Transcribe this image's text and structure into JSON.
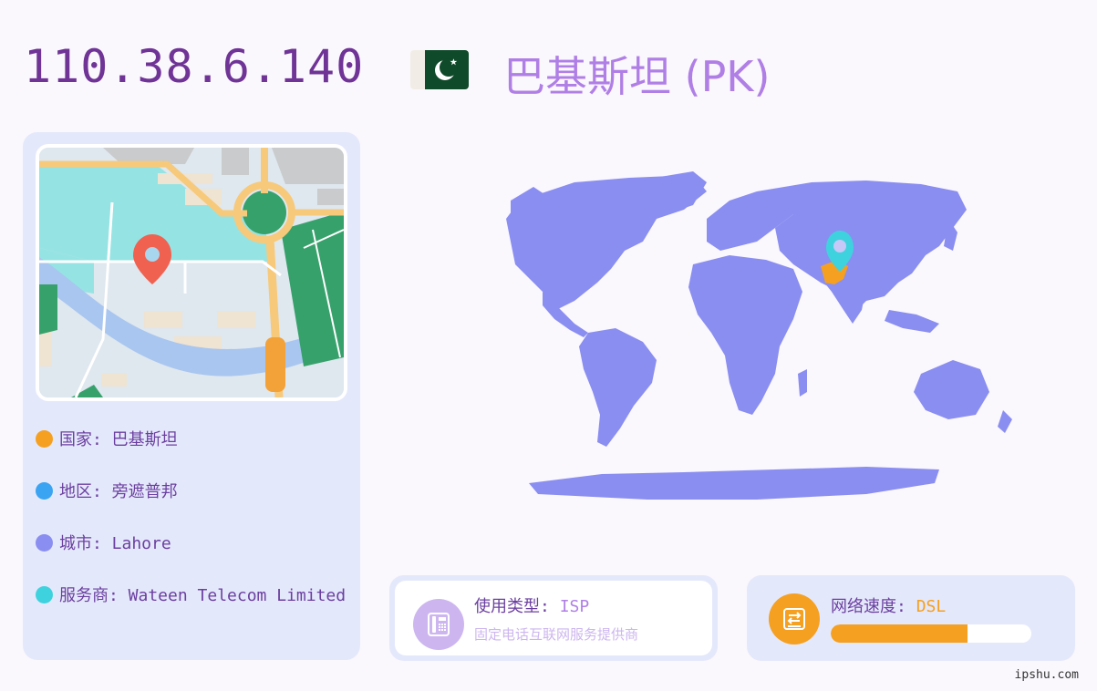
{
  "header": {
    "ip": "110.38.6.140",
    "country_title": "巴基斯坦 (PK)",
    "flag": {
      "icon": "pakistan-flag-icon",
      "green": "#0f4a2a",
      "white": "#f1ede6"
    }
  },
  "info": {
    "items": [
      {
        "label": "国家: 巴基斯坦",
        "color": "#f5a020"
      },
      {
        "label": "地区: 旁遮普邦",
        "color": "#3aa4f2"
      },
      {
        "label": "城市: Lahore",
        "color": "#8a8ef0"
      },
      {
        "label": "服务商: Wateen Telecom Limited",
        "color": "#3ed2de"
      }
    ]
  },
  "map": {
    "land_color": "#8a8ef0",
    "highlight_color": "#f5a020",
    "pin_color": "#3ed2de",
    "pin_icon": "location-pin-icon"
  },
  "usage": {
    "label": "使用类型",
    "value": "ISP",
    "desc": "固定电话互联网服务提供商",
    "icon": "telephone-icon",
    "icon_color": "#cdb6ef"
  },
  "speed": {
    "label": "网络速度",
    "value": "DSL",
    "level_percent": 68,
    "icon": "network-drive-icon",
    "icon_color": "#f5a020"
  },
  "watermark": "ipshu.com"
}
